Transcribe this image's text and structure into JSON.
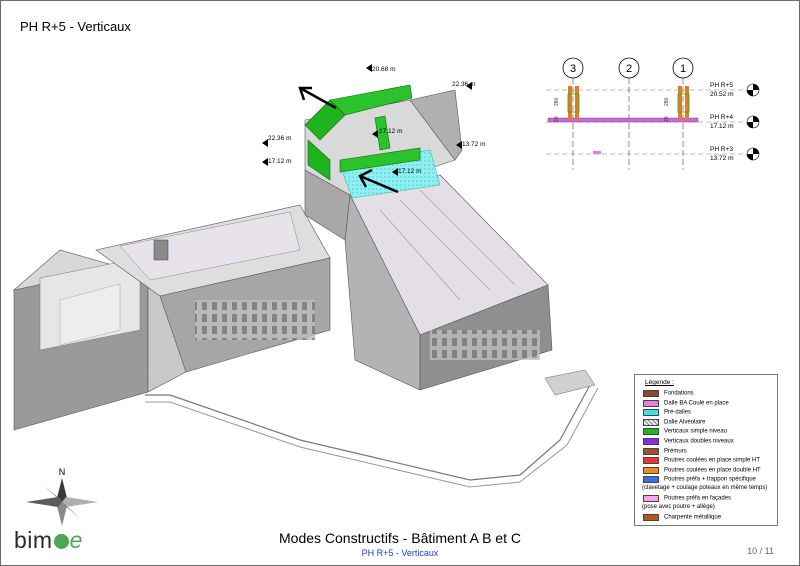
{
  "page_title": "PH R+5 - Verticaux",
  "footer": {
    "title": "Modes Constructifs - Bâtiment A B et C",
    "subtitle": "PH R+5 - Verticaux",
    "page_number": "10 / 11"
  },
  "logo": {
    "text": "bimoe"
  },
  "compass": {
    "label": "N"
  },
  "model_dimensions": [
    "20.68 m",
    "22.36 m",
    "22.36 m",
    "17.12 m",
    "17.12 m",
    "13.72 m",
    "17.12 m"
  ],
  "section": {
    "gridlines": [
      "3",
      "2",
      "1"
    ],
    "levels": [
      {
        "name": "PH R+5",
        "elevation": "20.52 m"
      },
      {
        "name": "PH R+4",
        "elevation": "17.12 m"
      },
      {
        "name": "PH R+3",
        "elevation": "13.72 m"
      }
    ],
    "small_dims": [
      "280",
      "20",
      "280",
      "20"
    ]
  },
  "legend": {
    "title": "Légende :",
    "items": [
      {
        "label": "Fondations",
        "color": "#8b4a2b"
      },
      {
        "label": "Dalle BA Coulé en place",
        "color": "#e87ddb"
      },
      {
        "label": "Pré-dalles",
        "color": "#3fe0e0"
      },
      {
        "label": "Dalle Alvéolaire",
        "color": "#bdbdbd",
        "hatched": true
      },
      {
        "label": "Verticaux simple niveau",
        "color": "#22b322"
      },
      {
        "label": "Verticaux doubles niveaux",
        "color": "#8a2be2"
      },
      {
        "label": "Prémurs",
        "color": "#a0522d"
      },
      {
        "label": "Poutres coulées en place simple HT",
        "color": "#e53b2c"
      },
      {
        "label": "Poutres coulées en place double HT",
        "color": "#f08a24"
      },
      {
        "label": "Poutres préfa + trappon spécifique",
        "color": "#3a6fe0"
      },
      {
        "label": "(clavetage + coulage poteaux en même temps)",
        "note": true
      },
      {
        "label": "Poutres préfa en façades",
        "color": "#f4a6e8"
      },
      {
        "label": "(pose avec poutre + allège)",
        "note": true
      },
      {
        "label": "Charpente métallique",
        "color": "#b8541e"
      }
    ]
  }
}
